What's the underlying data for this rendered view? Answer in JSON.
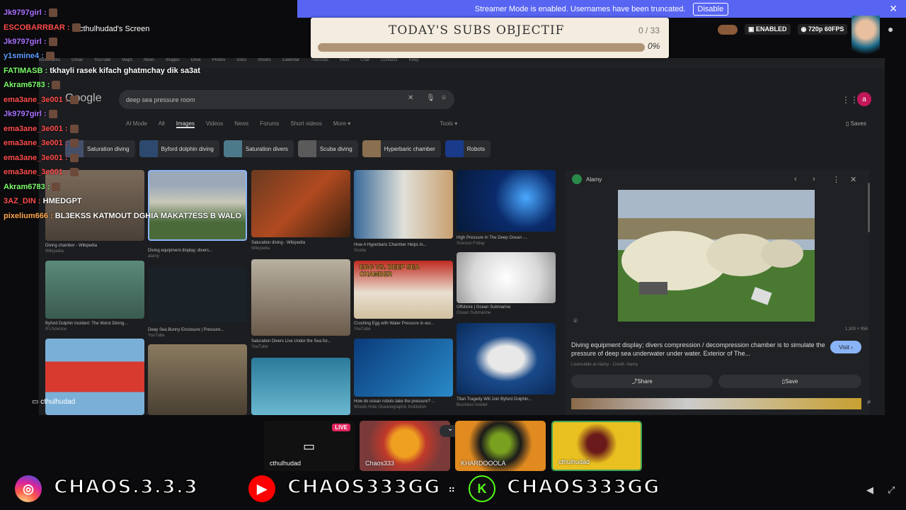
{
  "banner": {
    "text": "Streamer Mode is enabled. Usernames have been truncated.",
    "disable_label": "Disable",
    "close": "✕"
  },
  "screen_label": "cthulhudad's Screen",
  "browser": {
    "logo": "Google",
    "search_query": "deep sea pressure room",
    "filters": [
      "AI Mode",
      "All",
      "Images",
      "Videos",
      "News",
      "Forums",
      "Short videos",
      "More ▾"
    ],
    "active_filter": "Images",
    "tools": "Tools ▾",
    "saves": "Saves",
    "chips": [
      "Saturation diving",
      "Byford dolphin diving",
      "Saturation divers",
      "Scuba diving",
      "Hyperbaric chamber",
      "Robots"
    ],
    "results": [
      {
        "title": "Diving chamber - Wikipedia",
        "source": "Wikipedia"
      },
      {
        "title": "Diving equipment display; divers...",
        "source": "alamy"
      },
      {
        "title": "Saturation diving - Wikipedia",
        "source": "Wikipedia"
      },
      {
        "title": "How A Hyperbaric Chamber Helps In...",
        "source": "Scuba"
      },
      {
        "title": "High Pressure In The Deep Ocean -...",
        "source": "Science Friday"
      },
      {
        "title": "Byford Dolphin Incident: The Worst Diving...",
        "source": "IFLScience"
      },
      {
        "title": "Deep Sea Bunny Enclosure | Pressure...",
        "source": "YouTube"
      },
      {
        "title": "Saturation Divers Live Under the Sea for...",
        "source": "YouTube"
      },
      {
        "title": "Crushing Egg with Water Pressure in our...",
        "source": "YouTube"
      },
      {
        "title": "Offshore | Ocean Submarine",
        "source": "Ocean Submarine"
      },
      {
        "title": "How do ocean robots take the pressure? ...",
        "source": "Woods Hole Oceanographic Institution"
      },
      {
        "title": "Titan Tragedy Will Join Byford Dolphin...",
        "source": "Business Insider"
      }
    ],
    "egg_title": "EGG VS. DEEP SEA CHAMBER",
    "preview": {
      "site": "Alamy",
      "caption": "Diving equipment display; divers compression / decompression chamber is to simulate the pressure of deep sea underwater under water. Exterior of The...",
      "credit": "Licensable at Alamy · Credit: Alamy",
      "visit": "Visit ›",
      "share": "Share",
      "save": "Save",
      "dims": "1,300 × 956"
    }
  },
  "objectif": {
    "title": "TODAY'S SUBS OBJECTIF",
    "count": "0 / 33",
    "percent": "0%"
  },
  "chat": [
    {
      "user": "Jk9797girl :",
      "msg": "",
      "color": "#a970ff"
    },
    {
      "user": "ESCOBARRBAR :",
      "msg": "",
      "color": "#ff4d4d"
    },
    {
      "user": "Jk9797girl :",
      "msg": "",
      "color": "#a970ff"
    },
    {
      "user": "y1smine4 :",
      "msg": "",
      "color": "#5c9cff"
    },
    {
      "user": "FATIMASB :",
      "msg": "tkhayli rasek kifach ghatmchay dik sa3at",
      "color": "#7cfc6b"
    },
    {
      "user": "Akram6783 :",
      "msg": "",
      "color": "#7cfc6b"
    },
    {
      "user": "ema3ane_3e001 :",
      "msg": "",
      "color": "#ff4d4d"
    },
    {
      "user": "Jk9797girl :",
      "msg": "",
      "color": "#a970ff"
    },
    {
      "user": "ema3ane_3e001 :",
      "msg": "",
      "color": "#ff4d4d"
    },
    {
      "user": "ema3ane_3e001 :",
      "msg": "",
      "color": "#ff4d4d"
    },
    {
      "user": "ema3ane_3e001 :",
      "msg": "",
      "color": "#ff4d4d"
    },
    {
      "user": "ema3ane_3e001 :",
      "msg": "",
      "color": "#ff4d4d"
    },
    {
      "user": "Akram6783 :",
      "msg": "",
      "color": "#7cfc6b"
    },
    {
      "user": "3AZ_DIN :",
      "msg": "HMEDGPT",
      "color": "#ff4d4d"
    },
    {
      "user": "pixelium666 :",
      "msg": "BL3EKSS KATMOUT DGHIA MAKAT7ESS B WALO",
      "color": "#ffa64d"
    }
  ],
  "status": {
    "enabled": "ENABLED",
    "quality": "720p 60FPS"
  },
  "cams": [
    {
      "name": "cthulhudad",
      "live": "LIVE"
    },
    {
      "name": "Chaos333"
    },
    {
      "name": "KHARDOOOLA"
    },
    {
      "name": "cthulhudad"
    }
  ],
  "stream_user": "cthulhudad",
  "social": [
    "CHAOS.3.3.3",
    "CHAOS333GG",
    "CHAOS333GG"
  ],
  "colors": {
    "banner": "#5865f2",
    "objectif_bg": "#f3ecdf",
    "objectif_bar": "#b09476",
    "instagram": "#d62976",
    "youtube": "#ff0000",
    "kick": "#53fc18"
  }
}
